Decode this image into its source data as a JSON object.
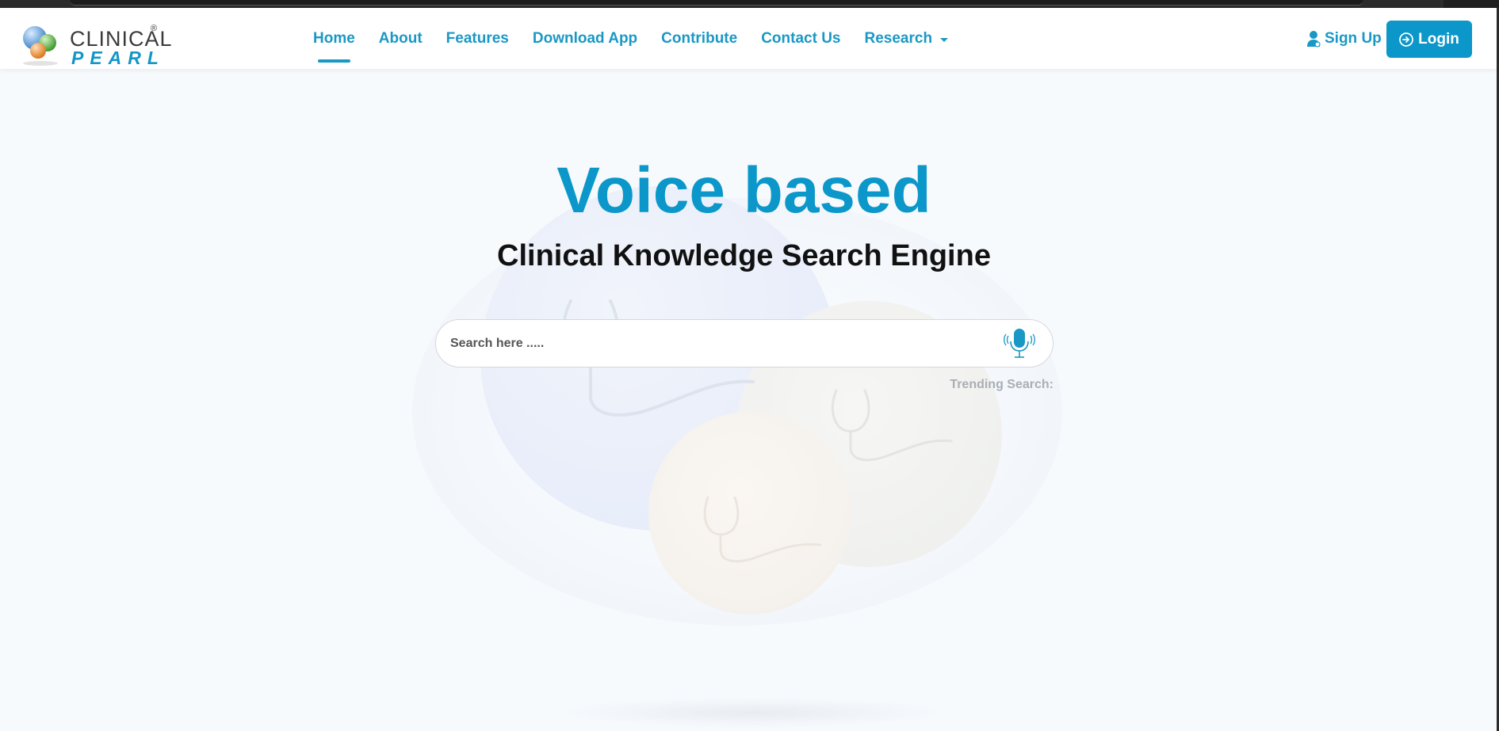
{
  "brand": {
    "name_top": "CLINICAL",
    "name_bottom": "PEARL",
    "registered_mark": "®",
    "colors": {
      "primary": "#0b97c9",
      "text": "#111111",
      "muted": "#a9afb5"
    }
  },
  "nav": {
    "items": [
      {
        "label": "Home",
        "active": true
      },
      {
        "label": "About",
        "active": false
      },
      {
        "label": "Features",
        "active": false
      },
      {
        "label": "Download App",
        "active": false
      },
      {
        "label": "Contribute",
        "active": false
      },
      {
        "label": "Contact Us",
        "active": false
      },
      {
        "label": "Research",
        "active": false,
        "has_dropdown": true
      }
    ],
    "signup_label": "Sign Up",
    "login_label": "Login"
  },
  "hero": {
    "title": "Voice based",
    "subtitle": "Clinical Knowledge Search Engine"
  },
  "search": {
    "placeholder": "Search here .....",
    "value": "",
    "trending_label": "Trending Search:"
  },
  "icons": {
    "signup": "user-icon",
    "login": "login-arrow-icon",
    "mic": "microphone-icon",
    "dropdown": "caret-down-icon"
  }
}
